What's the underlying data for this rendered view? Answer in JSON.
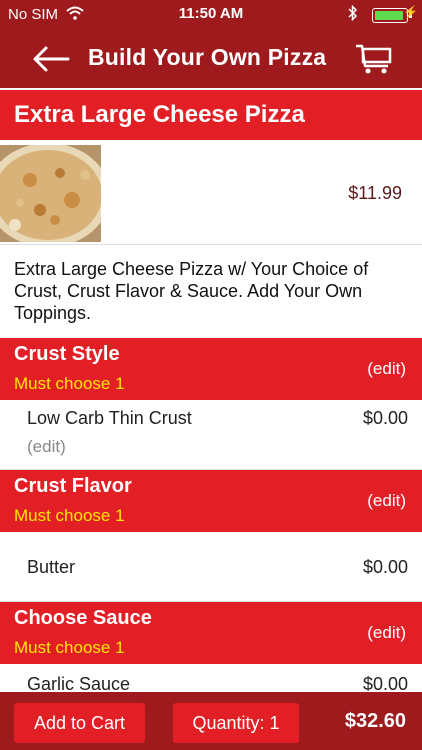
{
  "status_bar": {
    "carrier": "No SIM",
    "time": "11:50 AM",
    "wifi_icon": "wifi-icon",
    "bluetooth_icon": "bluetooth-icon",
    "battery_icon": "battery-icon",
    "charging_icon": "charging-bolt-icon"
  },
  "nav": {
    "title": "Build Your Own Pizza",
    "back_icon": "back-arrow-icon",
    "cart_icon": "cart-icon"
  },
  "item": {
    "name": "Extra Large Cheese Pizza",
    "price": "$11.99",
    "description": "Extra Large Cheese Pizza w/ Your Choice of Crust, Crust Flavor & Sauce. Add Your Own Toppings."
  },
  "groups": [
    {
      "title": "Crust Style",
      "requirement": "Must choose 1",
      "edit_label": "(edit)",
      "option_name": "Low Carb Thin Crust",
      "option_price": "$0.00",
      "option_edit": "(edit)"
    },
    {
      "title": "Crust Flavor",
      "requirement": "Must choose 1",
      "edit_label": "(edit)",
      "option_name": "Butter",
      "option_price": "$0.00"
    },
    {
      "title": "Choose Sauce",
      "requirement": "Must choose 1",
      "edit_label": "(edit)",
      "option_name": "Garlic Sauce",
      "option_price": "$0.00"
    }
  ],
  "footer": {
    "add_to_cart": "Add to Cart",
    "quantity": "Quantity: 1",
    "total": "$32.60"
  },
  "colors": {
    "header_dark_red": "#9e1a1c",
    "section_red": "#e31f26",
    "requirement_yellow": "#ffe600"
  }
}
